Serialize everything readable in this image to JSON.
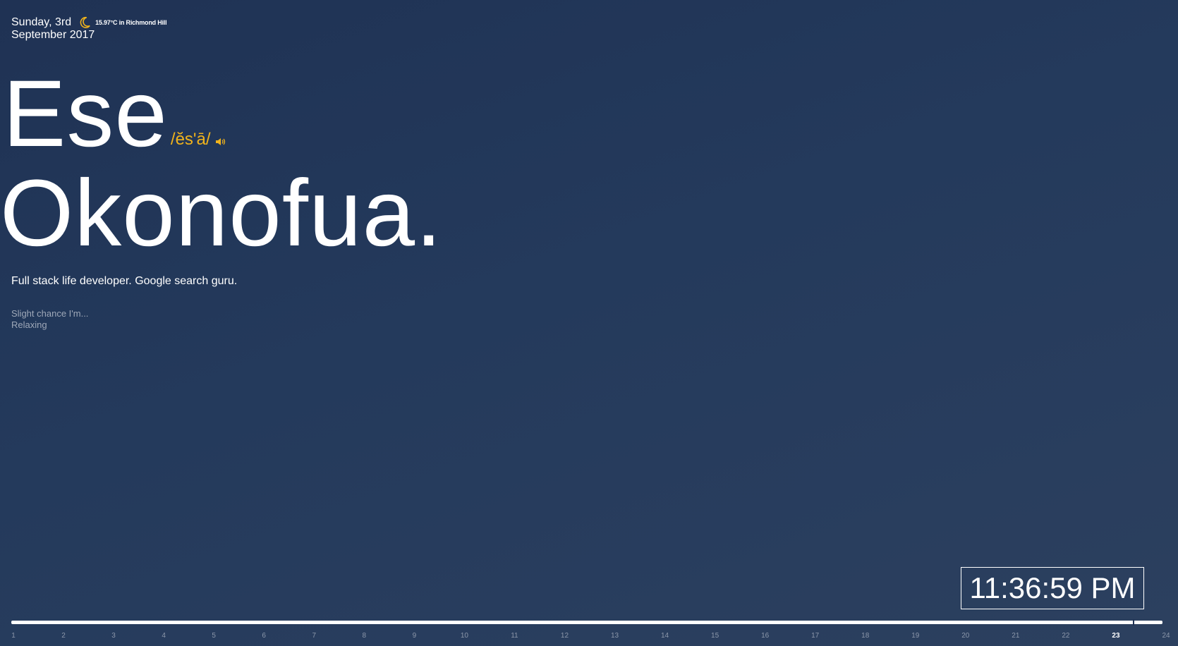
{
  "date": {
    "line1": "Sunday, 3rd",
    "line2": "September 2017"
  },
  "weather": {
    "icon": "moon-icon",
    "text": "15.97°C in Richmond Hill",
    "accent_color": "#f0b31c"
  },
  "name": {
    "first": "Ese",
    "pronunciation": "/ĕs'ā/",
    "last": "Okonofua."
  },
  "tagline": "Full stack life developer. Google search guru.",
  "status": {
    "intro": "Slight chance I'm...",
    "activity": "Relaxing"
  },
  "clock": {
    "time": "11:36:59 PM"
  },
  "timeline": {
    "hours": [
      "1",
      "2",
      "3",
      "4",
      "5",
      "6",
      "7",
      "8",
      "9",
      "10",
      "11",
      "12",
      "13",
      "14",
      "15",
      "16",
      "17",
      "18",
      "19",
      "20",
      "21",
      "22",
      "23",
      "24"
    ],
    "current_hour": "23",
    "progress_fraction": 0.983
  },
  "colors": {
    "background": "#223759",
    "accent": "#f0b31c",
    "text": "#ffffff",
    "muted": "#9ea8b8"
  }
}
